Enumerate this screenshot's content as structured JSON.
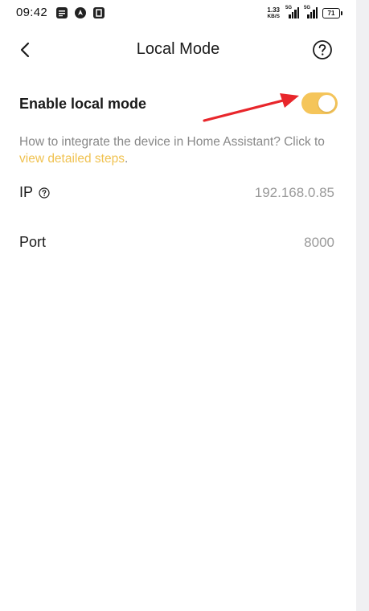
{
  "status_bar": {
    "time": "09:42",
    "net_speed_value": "1.33",
    "net_speed_unit": "KB/S",
    "signal_tags": [
      "5G",
      "5G"
    ],
    "battery": "71"
  },
  "header": {
    "title": "Local Mode",
    "back_icon": "chevron-left-icon",
    "help_icon": "help-circle-icon"
  },
  "local_mode": {
    "label": "Enable local mode",
    "enabled": true,
    "toggle_color": "#f5c55a",
    "annotation_arrow_color": "#e8262b"
  },
  "info": {
    "text": "How to integrate the device in Home Assistant? Click to ",
    "link": "view detailed steps",
    "suffix": ".",
    "link_color": "#f0c250"
  },
  "details": {
    "ip_label": "IP",
    "ip_value": "192.168.0.85",
    "port_label": "Port",
    "port_value": "8000"
  }
}
